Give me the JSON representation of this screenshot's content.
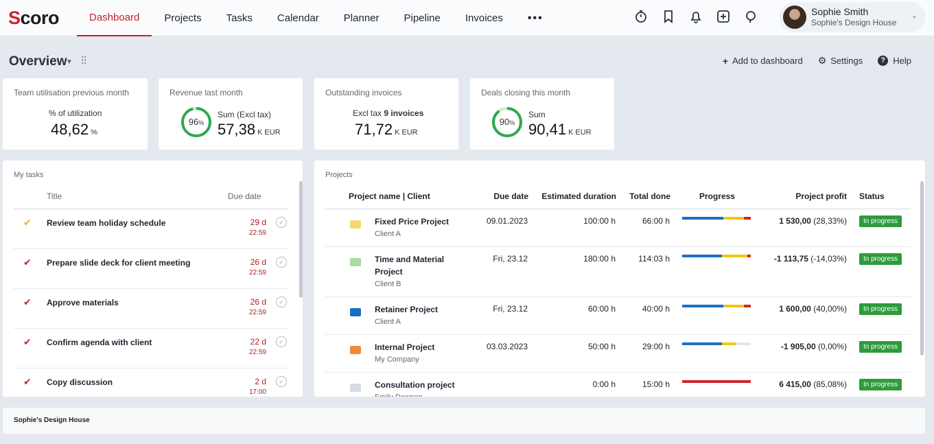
{
  "nav": {
    "logo_mark": "S",
    "logo_rest": "coro",
    "items": [
      "Dashboard",
      "Projects",
      "Tasks",
      "Calendar",
      "Planner",
      "Pipeline",
      "Invoices",
      "•••"
    ],
    "active_index": 0,
    "icons": [
      "timer-icon",
      "bookmark-icon",
      "bell-icon",
      "add-icon",
      "search-icon"
    ],
    "user": {
      "name": "Sophie Smith",
      "company": "Sophie's Design House"
    }
  },
  "overview": {
    "title": "Overview",
    "actions": {
      "add": "Add to dashboard",
      "settings": "Settings",
      "help": "Help"
    }
  },
  "kpis": [
    {
      "label": "Team utilisation previous month",
      "sub": "% of utilization",
      "value": "48,62",
      "unit": "%"
    },
    {
      "label": "Revenue last month",
      "sub": "Sum (Excl tax)",
      "value": "57,38",
      "unit_k": "K",
      "unit": "EUR",
      "ring": "96",
      "ring_pct": 0.96
    },
    {
      "label": "Outstanding invoices",
      "sub_prefix": "Excl tax ",
      "sub_bold": "9 invoices",
      "value": "71,72",
      "unit_k": "K",
      "unit": "EUR"
    },
    {
      "label": "Deals closing this month",
      "sub": "Sum",
      "value": "90,41",
      "unit_k": "K",
      "unit": "EUR",
      "ring": "90",
      "ring_pct": 0.9
    }
  ],
  "tasks": {
    "title": "My tasks",
    "headers": {
      "title": "Title",
      "due": "Due date"
    },
    "items": [
      {
        "title": "Review team holiday schedule",
        "days": "29 d",
        "time": "22:59",
        "check_color": "#e8b400"
      },
      {
        "title": "Prepare slide deck for client meeting",
        "days": "26 d",
        "time": "22:59",
        "check_color": "#c8202b"
      },
      {
        "title": "Approve materials",
        "days": "26 d",
        "time": "22:59",
        "check_color": "#c8202b"
      },
      {
        "title": "Confirm agenda with client",
        "days": "22 d",
        "time": "22:59",
        "check_color": "#c8202b"
      },
      {
        "title": "Copy discussion",
        "days": "2 d",
        "time": "17:00",
        "check_color": "#c8202b"
      }
    ]
  },
  "projects": {
    "title": "Projects",
    "headers": {
      "name": "Project name | Client",
      "due": "Due date",
      "est": "Estimated duration",
      "total": "Total done",
      "progress": "Progress",
      "profit": "Project profit",
      "status": "Status"
    },
    "items": [
      {
        "name": "Fixed Price Project",
        "client": "Client A",
        "due": "09.01.2023",
        "est": "100:00 h",
        "total": "66:00 h",
        "profit_bold": "1 530,00",
        "profit_pct": " (28,33%)",
        "status": "In progress",
        "color": "#f5d96b",
        "progress": [
          [
            "#1b6fc2",
            0.6
          ],
          [
            "#f2c714",
            0.3
          ],
          [
            "#d4232b",
            0.1
          ]
        ]
      },
      {
        "name": "Time and Material Project",
        "client": "Client B",
        "due": "Fri, 23.12",
        "est": "180:00 h",
        "total": "114:03 h",
        "profit_bold": "-1 113,75",
        "profit_pct": " (-14,03%)",
        "status": "In progress",
        "color": "#a8dca0",
        "progress": [
          [
            "#1b6fc2",
            0.58
          ],
          [
            "#f2c714",
            0.37
          ],
          [
            "#d4232b",
            0.05
          ]
        ]
      },
      {
        "name": "Retainer Project",
        "client": "Client A",
        "due": "Fri, 23.12",
        "est": "60:00 h",
        "total": "40:00 h",
        "profit_bold": "1 600,00",
        "profit_pct": " (40,00%)",
        "status": "In progress",
        "color": "#1b6fc2",
        "progress": [
          [
            "#1b6fc2",
            0.6
          ],
          [
            "#f2c714",
            0.3
          ],
          [
            "#d4232b",
            0.1
          ]
        ]
      },
      {
        "name": "Internal Project",
        "client": "My Company",
        "due": "03.03.2023",
        "est": "50:00 h",
        "total": "29:00 h",
        "profit_bold": "-1 905,00",
        "profit_pct": " (0,00%)",
        "status": "In progress",
        "color": "#ef8a3a",
        "progress": [
          [
            "#1b6fc2",
            0.58
          ],
          [
            "#f2c714",
            0.2
          ]
        ]
      },
      {
        "name": "Consultation project",
        "client": "Emily Dawson",
        "due": "",
        "est": "0:00 h",
        "total": "15:00 h",
        "profit_bold": "6 415,00",
        "profit_pct": " (85,08%)",
        "status": "In progress",
        "color": "#d3dbe6",
        "progress": [
          [
            "#d4232b",
            1.0
          ]
        ]
      }
    ]
  },
  "footer": {
    "company": "Sophie's Design House"
  }
}
